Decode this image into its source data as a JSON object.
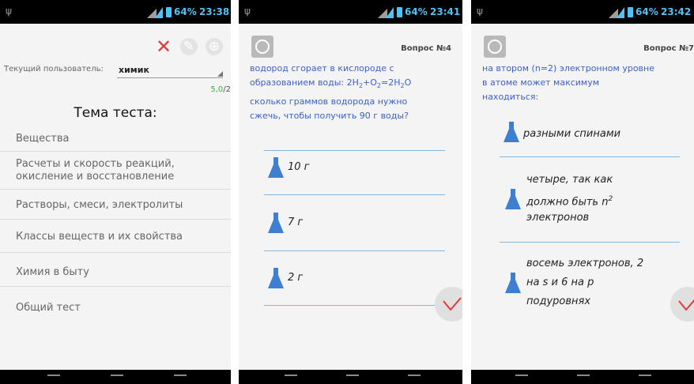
{
  "screens": [
    {
      "status": {
        "battery": "64%",
        "time": "23:38"
      },
      "toolbar": {
        "delete_icon": "close-icon",
        "edit_icon": "pencil-icon",
        "add_icon": "plus-circle-icon"
      },
      "user": {
        "label": "Текущий пользователь:",
        "value": "химик"
      },
      "score": {
        "current": "5,0",
        "total": "/2"
      },
      "topic_title": "Тема теста:",
      "topics": [
        {
          "label": "Вещества"
        },
        {
          "label": "Расчеты и скорость реакций, окисление и восстановление"
        },
        {
          "label": "Растворы, смеси, электролиты"
        },
        {
          "label": "Классы веществ и их свойства"
        },
        {
          "label": "Химия в быту"
        },
        {
          "label": "Общий тест"
        }
      ]
    },
    {
      "status": {
        "battery": "64%",
        "time": "23:41"
      },
      "question_number": "Вопрос №4",
      "question_line1": "водород сгорает в кислороде с",
      "question_line2": "образованием воды:",
      "formula": {
        "a": "2H",
        "a_sub": "2",
        "plus": "+O",
        "plus_sub": "2",
        "eq": "=2H",
        "eq_sub": "2",
        "end": "O"
      },
      "question_line3": "сколько граммов водорода нужно",
      "question_line4": "сжечь, чтобы получить 90 г воды?",
      "answers": [
        {
          "label": "10 г"
        },
        {
          "label": "7 г"
        },
        {
          "label": "2 г"
        }
      ]
    },
    {
      "status": {
        "battery": "64%",
        "time": "23:42"
      },
      "question_number": "Вопрос №7",
      "question_line1": "на втором (n=2) электронном уровне",
      "question_line2": "в атоме может максимум",
      "question_line3": "находиться:",
      "answers": [
        {
          "line1": "разными спинами"
        },
        {
          "line1": "четыре, так как",
          "line2": "должно быть n",
          "sup": "2",
          "line3": "электронов"
        },
        {
          "line1": "восемь электронов, 2",
          "line2": "на s и 6 на p",
          "line3": "подуровнях"
        }
      ]
    }
  ],
  "colors": {
    "accent_blue": "#3a5fcf",
    "flask_blue": "#3e7fd2",
    "check_red": "#e53935",
    "delete_red": "#e53935",
    "score_green": "#3cb043"
  }
}
